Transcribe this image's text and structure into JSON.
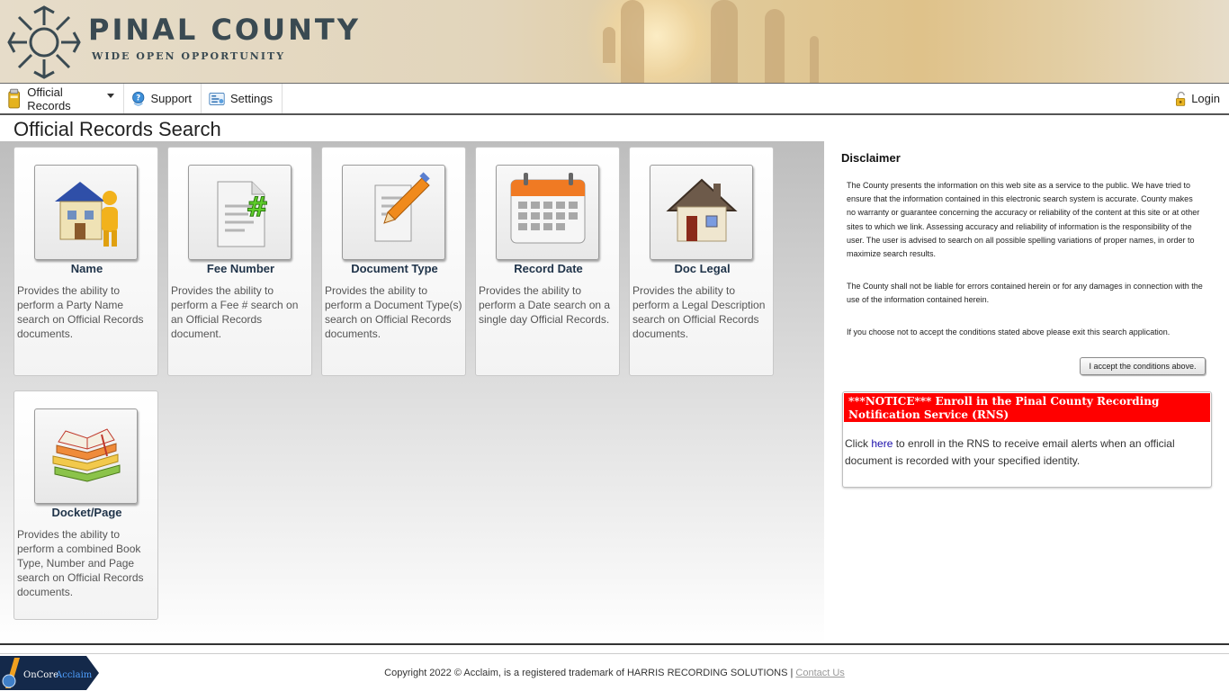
{
  "header": {
    "title": "PINAL COUNTY",
    "subtitle": "WIDE OPEN OPPORTUNITY"
  },
  "nav": {
    "items": [
      {
        "label": "Official Records",
        "icon": "records-icon",
        "dropdown": true
      },
      {
        "label": "Support",
        "icon": "support-icon"
      },
      {
        "label": "Settings",
        "icon": "settings-icon"
      }
    ],
    "login_label": "Login"
  },
  "page_title": "Official Records Search",
  "tiles": [
    {
      "name": "Name",
      "icon": "party-name-icon",
      "description": "Provides the ability to perform a Party Name search on Official Records documents."
    },
    {
      "name": "Fee Number",
      "icon": "fee-number-icon",
      "description": "Provides the ability to perform a Fee # search on an Official Records document."
    },
    {
      "name": "Document Type",
      "icon": "document-type-icon",
      "description": "Provides the ability to perform a Document Type(s) search on Official Records documents."
    },
    {
      "name": "Record Date",
      "icon": "calendar-icon",
      "description": "Provides the ability to perform a Date search on a single day Official Records."
    },
    {
      "name": "Doc Legal",
      "icon": "house-icon",
      "description": "Provides the ability to perform a Legal Description search on Official Records documents."
    },
    {
      "name": "Docket/Page",
      "icon": "books-icon",
      "description": "Provides the ability to perform a combined Book Type, Number and Page search on Official Records documents."
    }
  ],
  "disclaimer": {
    "title": "Disclaimer",
    "p1": "The County presents the information on this web site as a service to the public. We have tried to ensure that the information contained in this electronic search system is accurate. County makes no warranty or guarantee concerning the accuracy or reliability of the content at this site or at other sites to which we link. Assessing accuracy and reliability of information is the responsibility of the user. The user is advised to search on all possible spelling variations of proper names, in order to maximize search results.",
    "p2": "The County shall not be liable for errors contained herein or for any damages in connection with the use of the information contained herein.",
    "p3": "If you choose not to accept the conditions stated above please exit this search application.",
    "accept_label": "I accept the conditions above."
  },
  "notice": {
    "heading": "***NOTICE*** Enroll in the Pinal County Recording Notification Service (RNS)",
    "body_prefix": "Click ",
    "link_text": "here",
    "body_suffix": " to enroll in the RNS to receive email alerts when an official document is recorded with your specified identity."
  },
  "footer": {
    "logo_text_1": "OnCore",
    "logo_text_2": "Acclaim",
    "copyright": "Copyright 2022 © Acclaim, is a registered trademark of HARRIS RECORDING SOLUTIONS | ",
    "contact_label": "Contact Us"
  },
  "colors": {
    "notice_red": "#ff0000",
    "tile_title": "#1f3349",
    "brand_slate": "#3a4a52"
  }
}
